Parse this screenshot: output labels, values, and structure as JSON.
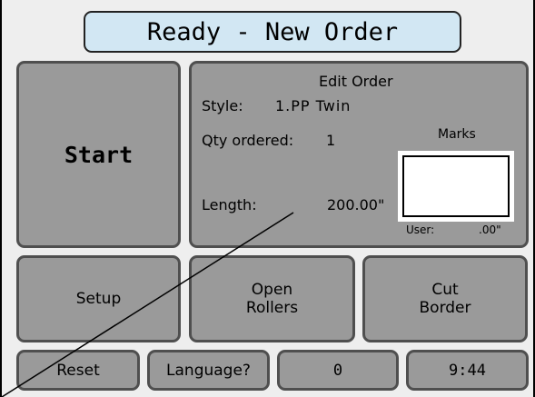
{
  "header": {
    "title": "Ready - New Order"
  },
  "buttons": {
    "start": "Start",
    "setup": "Setup",
    "open_rollers": "Open\nRollers",
    "cut_border": "Cut\nBorder",
    "reset": "Reset",
    "language": "Language?",
    "counter": "0",
    "time": "9:44"
  },
  "order": {
    "heading": "Edit Order",
    "style_label": "Style:",
    "style_value": "1.PP Twin",
    "qty_label": "Qty ordered:",
    "qty_value": "1",
    "length_label": "Length:",
    "length_value": "200.00\"",
    "marks_label": "Marks",
    "user_label": "User:",
    "user_value": ".00\""
  },
  "colors": {
    "title_bg": "#d2e7f3",
    "button_bg": "#9a9a9a",
    "button_border": "#4f4f4f",
    "screen_bg": "#eeeeee"
  }
}
